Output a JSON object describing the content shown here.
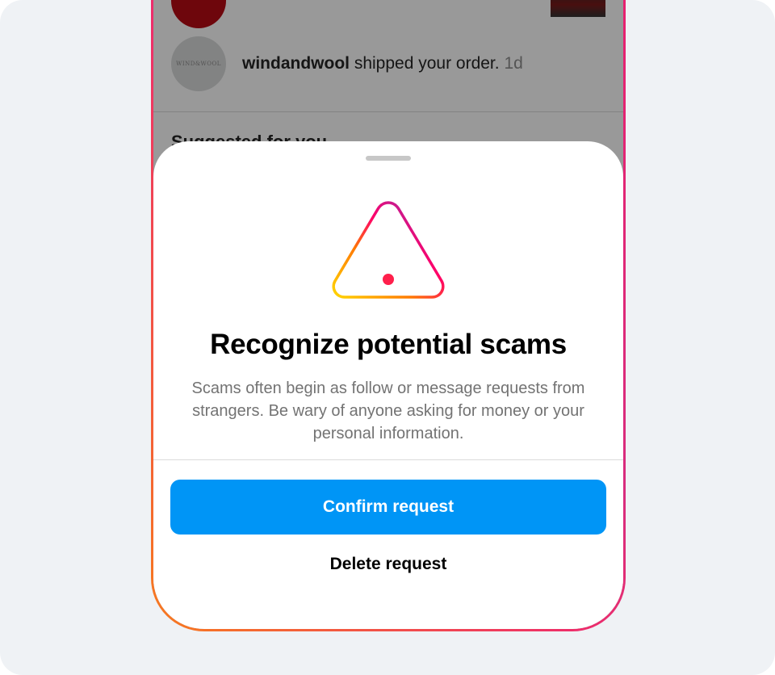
{
  "feed": {
    "notification": {
      "username": "windandwool",
      "message": " shipped your order.",
      "time": " 1d"
    },
    "avatar_logo_text": "WIND&WOOL",
    "section_title": "Suggested for you"
  },
  "sheet": {
    "icon": "warning-triangle-icon",
    "title": "Recognize potential scams",
    "description": "Scams often begin as follow or message requests from strangers. Be wary of anyone asking for money or your personal information.",
    "confirm_label": "Confirm request",
    "delete_label": "Delete request"
  },
  "colors": {
    "page_background": "#eff2f5",
    "primary_button": "#0095f6",
    "frame_gradient": [
      "#f77b1e",
      "#ee2d6a",
      "#d82d7e"
    ],
    "warning_gradient": [
      "#ffd600",
      "#ff2d6f",
      "#8a3ab9"
    ]
  }
}
